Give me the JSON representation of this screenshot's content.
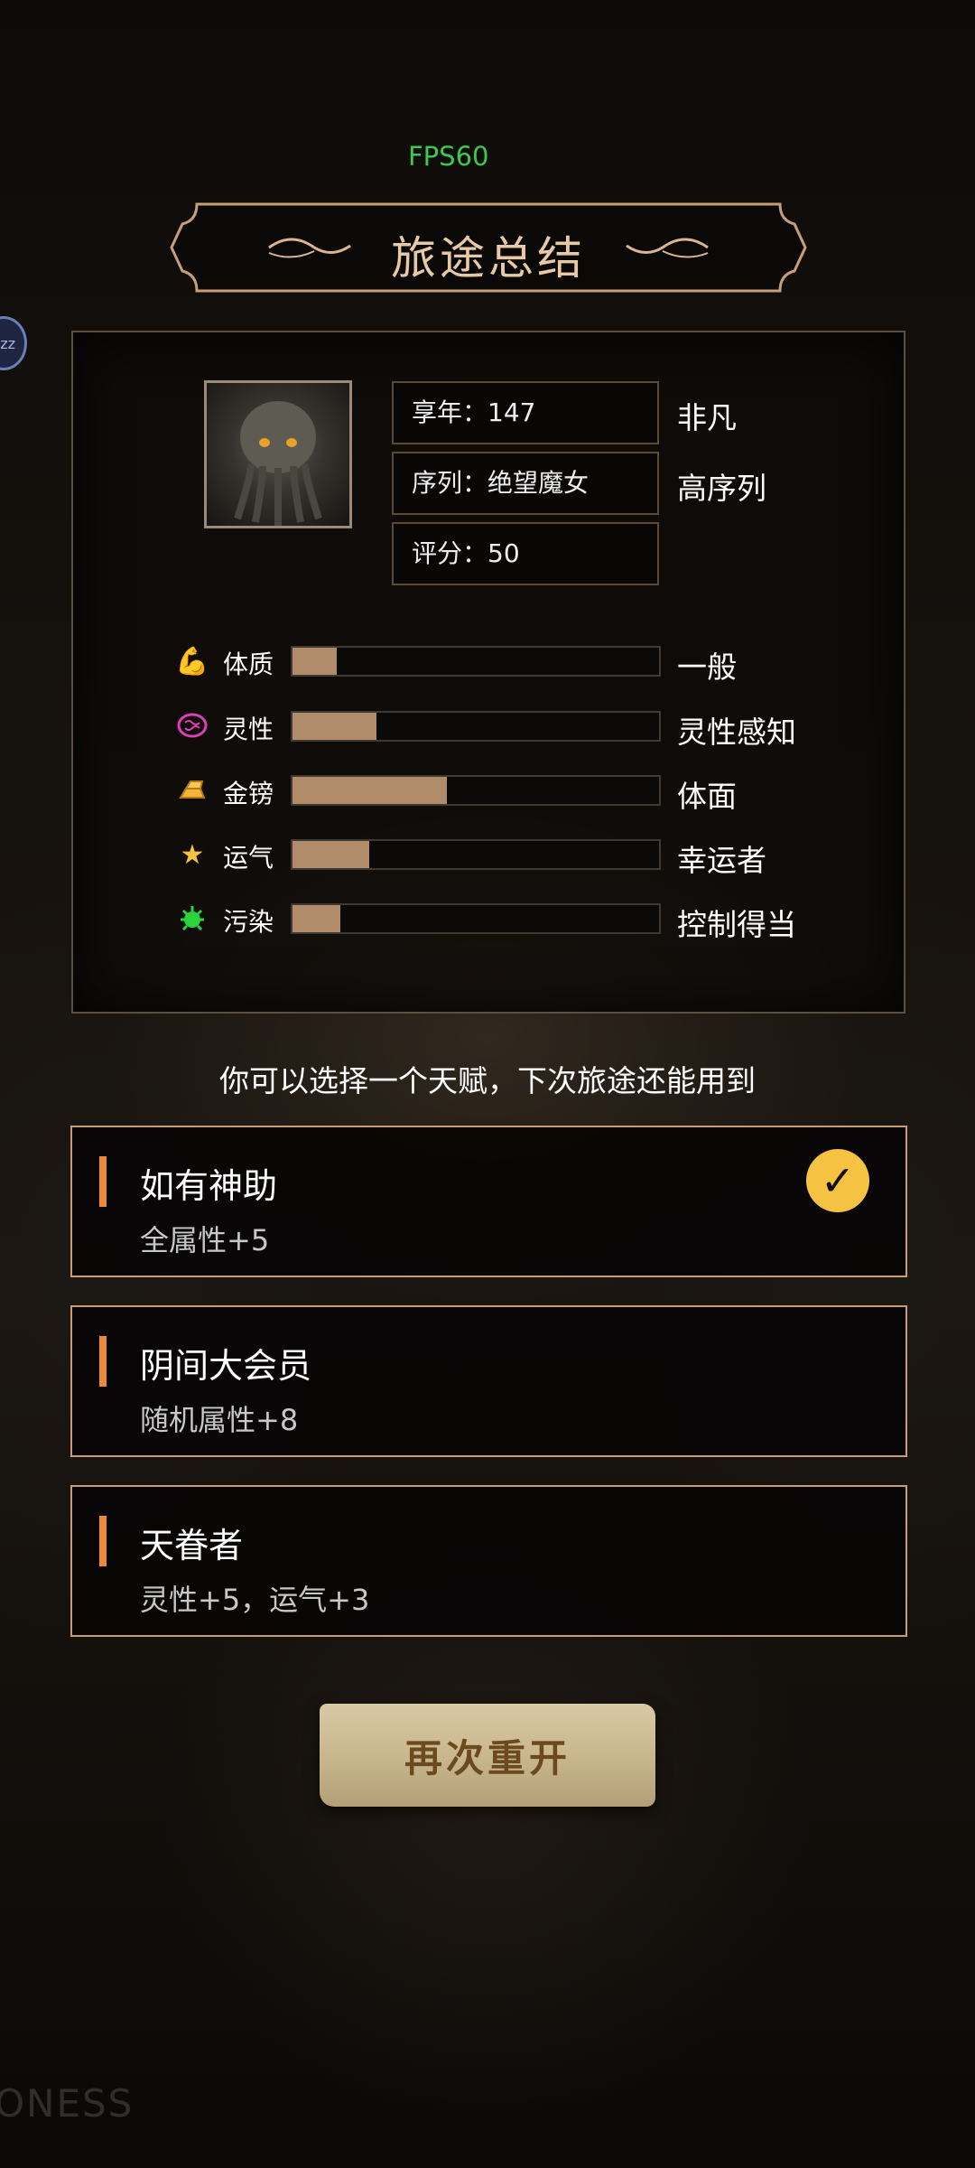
{
  "fps": "FPS60",
  "side_badge": "zz",
  "title": "旅途总结",
  "info": {
    "age": "享年：147",
    "age_tag": "非凡",
    "sequence": "序列：绝望魔女",
    "sequence_tag": "高序列",
    "score": "评分：50"
  },
  "stats": [
    {
      "icon": "muscle-icon",
      "label": "体质",
      "level": 0.12,
      "desc": "一般"
    },
    {
      "icon": "brain-icon",
      "label": "灵性",
      "level": 0.23,
      "desc": "灵性感知"
    },
    {
      "icon": "gold-bars-icon",
      "label": "金镑",
      "level": 0.42,
      "desc": "体面"
    },
    {
      "icon": "star-icon",
      "label": "运气",
      "level": 0.21,
      "desc": "幸运者"
    },
    {
      "icon": "virus-icon",
      "label": "污染",
      "level": 0.13,
      "desc": "控制得当"
    }
  ],
  "hint": "你可以选择一个天赋，下次旅途还能用到",
  "talents": [
    {
      "name": "如有神助",
      "desc": "全属性+5",
      "selected": true
    },
    {
      "name": "阴间大会员",
      "desc": "随机属性+8",
      "selected": false
    },
    {
      "name": "天眷者",
      "desc": "灵性+5，运气+3",
      "selected": false
    }
  ],
  "restart_label": "再次重开",
  "watermark": "ONESS",
  "colors": {
    "accent": "#ec8a3c",
    "bar_fill": "#b08c6a",
    "border": "#c99c76",
    "check": "#f6c242",
    "fps": "#3fc94a"
  }
}
